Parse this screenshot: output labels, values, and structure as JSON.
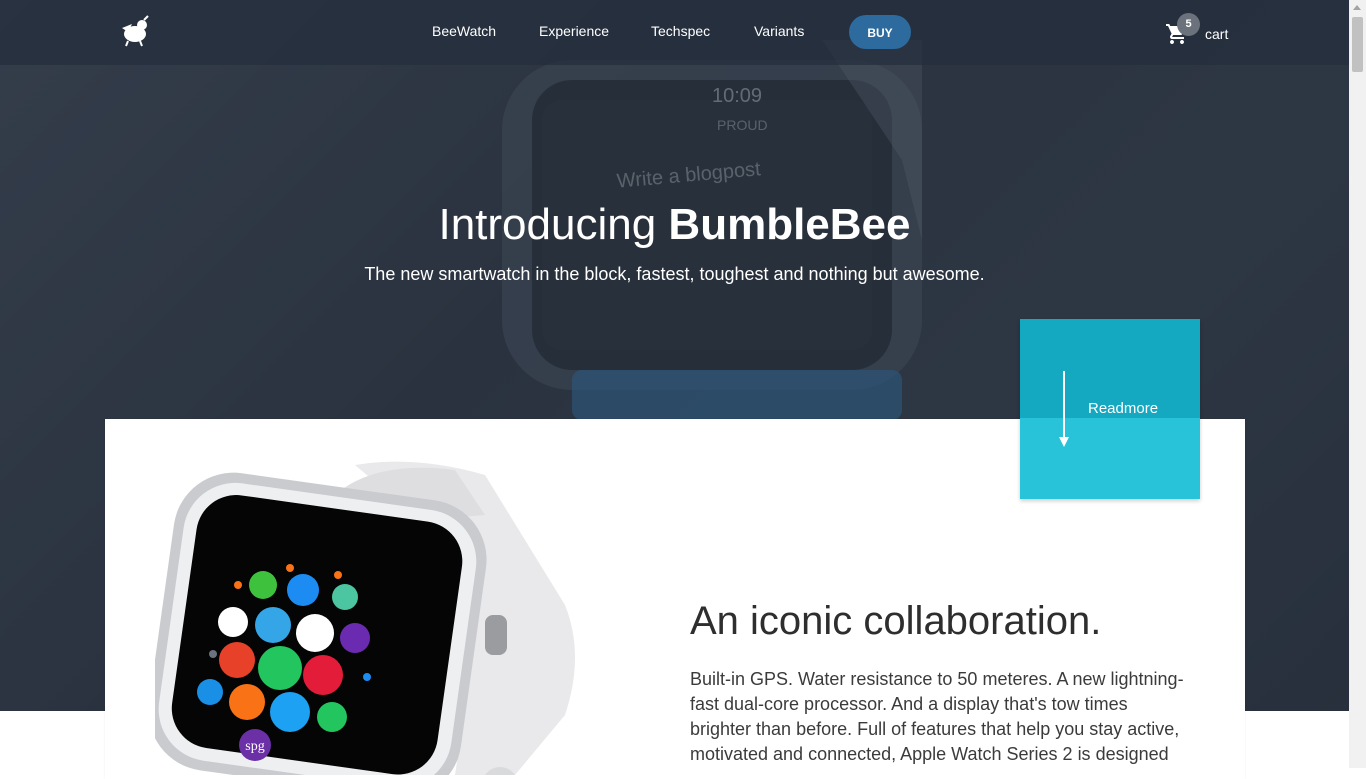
{
  "nav": {
    "links": [
      {
        "label": "BeeWatch"
      },
      {
        "label": "Experience"
      },
      {
        "label": "Techspec"
      },
      {
        "label": "Variants"
      }
    ],
    "buy_label": "BUY",
    "cart": {
      "count": "5",
      "label": "cart"
    }
  },
  "hero": {
    "title_prefix": "Introducing ",
    "title_bold": "BumbleBee",
    "subtitle": "The new smartwatch in the block, fastest, toughest and nothing but awesome.",
    "screen": {
      "time": "10:09",
      "status": "PROUD",
      "task": "Write a blogpost"
    }
  },
  "readmore": {
    "label": "Readmore"
  },
  "section": {
    "heading": "An iconic collaboration.",
    "body": "Built-in GPS. Water resistance to 50 meteres. A new lightning-fast dual-core processor. And a display that's tow times brighter than before. Full of features that help you stay active, motivated and connected, Apple Watch Series 2 is designed"
  },
  "watch_icons": {
    "spg_label": "spg"
  },
  "colors": {
    "nav_bg": "#242e3d",
    "buy_button": "#2d6b9e",
    "readmore_top": "#14a8c1",
    "readmore_bottom": "#29c3d9"
  },
  "icons": [
    "logo-icon",
    "cart-icon",
    "arrow-down-icon"
  ]
}
